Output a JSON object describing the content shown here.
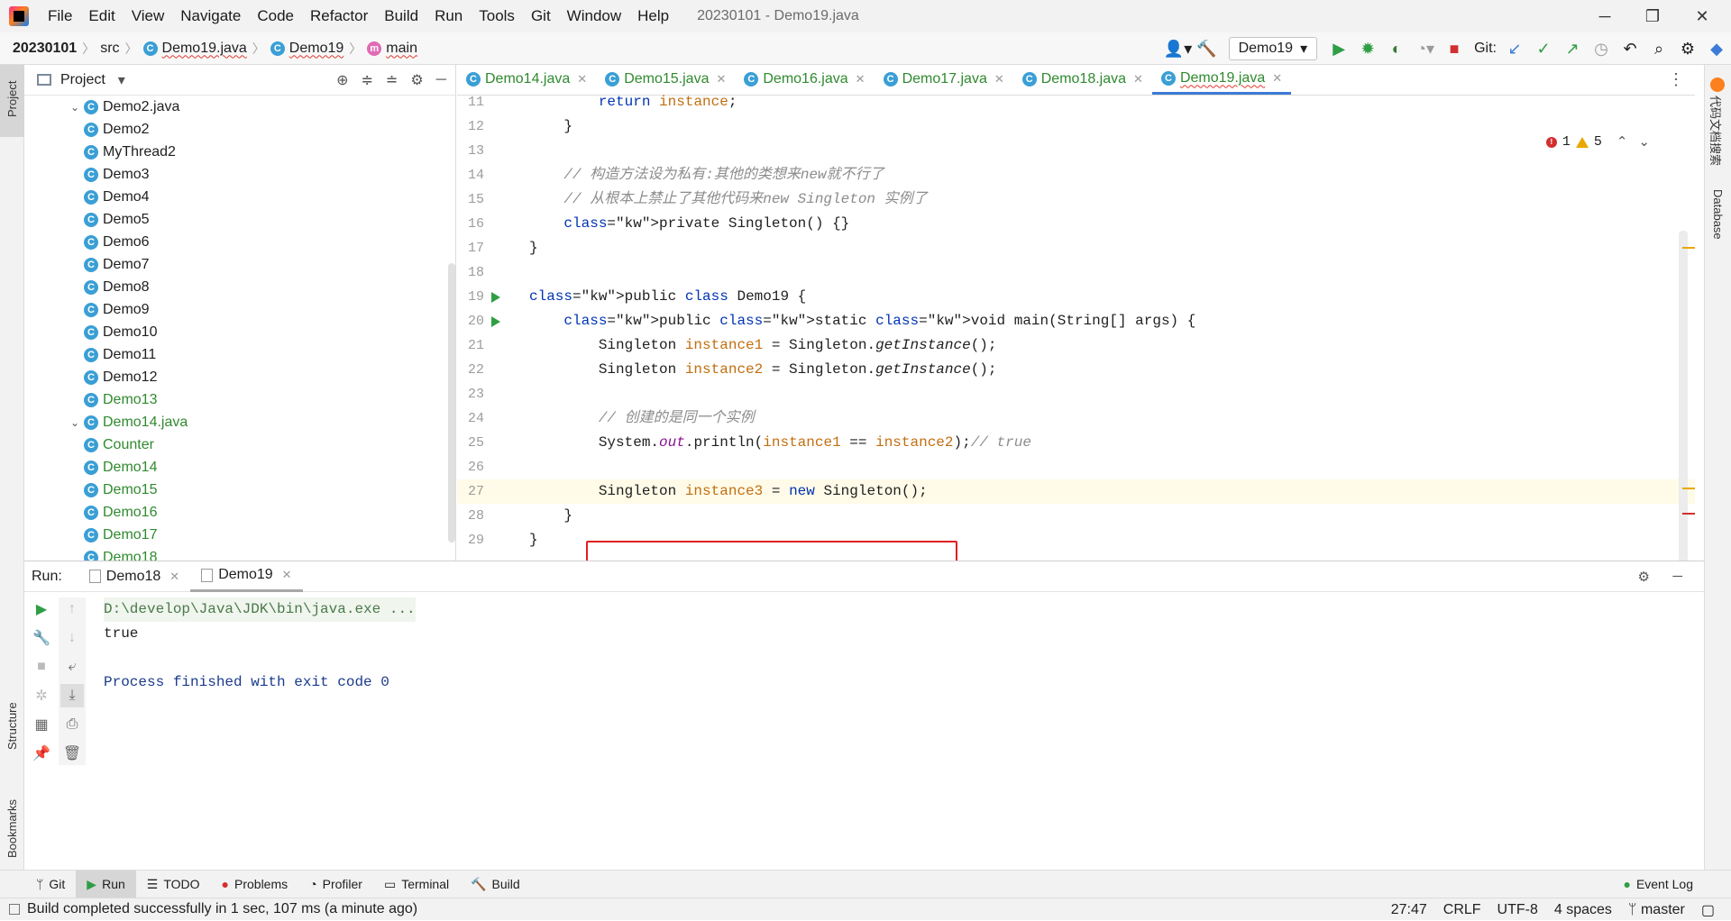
{
  "menubar": {
    "items": [
      "File",
      "Edit",
      "View",
      "Navigate",
      "Code",
      "Refactor",
      "Build",
      "Run",
      "Tools",
      "Git",
      "Window",
      "Help"
    ],
    "window_title": "20230101 - Demo19.java",
    "controls": {
      "minimize": "─",
      "restore": "❐",
      "close": "✕"
    }
  },
  "navbar": {
    "project": "20230101",
    "crumbs": [
      "src",
      "Demo19.java",
      "Demo19",
      "main"
    ],
    "run_config": "Demo19",
    "git_label": "Git:"
  },
  "left_strip": {
    "project": "Project",
    "structure": "Structure",
    "bookmarks": "Bookmarks"
  },
  "right_strip": {
    "code_search": "代码文档搜索",
    "database": "Database"
  },
  "project_pane": {
    "title": "Project",
    "tree": [
      {
        "label": "Demo2.java",
        "expanded": true,
        "level": 1,
        "green": false
      },
      {
        "label": "Demo2",
        "level": 2,
        "green": false
      },
      {
        "label": "MyThread2",
        "level": 2,
        "green": false
      },
      {
        "label": "Demo3",
        "level": 1,
        "green": false
      },
      {
        "label": "Demo4",
        "level": 1,
        "green": false
      },
      {
        "label": "Demo5",
        "level": 1,
        "green": false
      },
      {
        "label": "Demo6",
        "level": 1,
        "green": false
      },
      {
        "label": "Demo7",
        "level": 1,
        "green": false
      },
      {
        "label": "Demo8",
        "level": 1,
        "green": false
      },
      {
        "label": "Demo9",
        "level": 1,
        "green": false
      },
      {
        "label": "Demo10",
        "level": 1,
        "green": false
      },
      {
        "label": "Demo11",
        "level": 1,
        "green": false
      },
      {
        "label": "Demo12",
        "level": 1,
        "green": false
      },
      {
        "label": "Demo13",
        "level": 1,
        "green": true
      },
      {
        "label": "Demo14.java",
        "expanded": true,
        "level": 1,
        "green": true
      },
      {
        "label": "Counter",
        "level": 2,
        "green": true
      },
      {
        "label": "Demo14",
        "level": 2,
        "green": true
      },
      {
        "label": "Demo15",
        "level": 1,
        "green": true
      },
      {
        "label": "Demo16",
        "level": 1,
        "green": true
      },
      {
        "label": "Demo17",
        "level": 1,
        "green": true
      },
      {
        "label": "Demo18",
        "level": 1,
        "green": true
      }
    ]
  },
  "editor": {
    "tabs": [
      "Demo14.java",
      "Demo15.java",
      "Demo16.java",
      "Demo17.java",
      "Demo18.java",
      "Demo19.java"
    ],
    "active_tab": "Demo19.java",
    "inspection": {
      "errors": "1",
      "warnings": "5"
    },
    "lines": [
      {
        "n": "11",
        "code": "        return instance;"
      },
      {
        "n": "12",
        "code": "    }"
      },
      {
        "n": "13",
        "code": ""
      },
      {
        "n": "14",
        "code": "    // 构造方法设为私有:其他的类想来new就不行了"
      },
      {
        "n": "15",
        "code": "    // 从根本上禁止了其他代码来new Singleton 实例了"
      },
      {
        "n": "16",
        "code": "    private Singleton() {}"
      },
      {
        "n": "17",
        "code": "}"
      },
      {
        "n": "18",
        "code": ""
      },
      {
        "n": "19",
        "code": "public class Demo19 {"
      },
      {
        "n": "20",
        "code": "    public static void main(String[] args) {"
      },
      {
        "n": "21",
        "code": "        Singleton instance1 = Singleton.getInstance();"
      },
      {
        "n": "22",
        "code": "        Singleton instance2 = Singleton.getInstance();"
      },
      {
        "n": "23",
        "code": ""
      },
      {
        "n": "24",
        "code": "        // 创建的是同一个实例"
      },
      {
        "n": "25",
        "code": "        System.out.println(instance1 == instance2);// true"
      },
      {
        "n": "26",
        "code": ""
      },
      {
        "n": "27",
        "code": "        Singleton instance3 = new Singleton();"
      },
      {
        "n": "28",
        "code": "    }"
      },
      {
        "n": "29",
        "code": "}"
      }
    ]
  },
  "run_panel": {
    "label": "Run:",
    "tabs": [
      "Demo18",
      "Demo19"
    ],
    "active_tab": "Demo19",
    "console": [
      "D:\\develop\\Java\\JDK\\bin\\java.exe ...",
      "true",
      "",
      "Process finished with exit code 0"
    ]
  },
  "bottom_tabs": [
    "Git",
    "Run",
    "TODO",
    "Problems",
    "Profiler",
    "Terminal",
    "Build",
    "Event Log"
  ],
  "statusbar": {
    "message": "Build completed successfully in 1 sec, 107 ms (a minute ago)",
    "position": "27:47",
    "line_sep": "CRLF",
    "encoding": "UTF-8",
    "indent": "4 spaces",
    "branch": "master"
  },
  "colors": {
    "accent": "#3d7cd6",
    "highlight_box": "#e02020",
    "run_green": "#2f9e44",
    "error_red": "#d32f2f"
  }
}
